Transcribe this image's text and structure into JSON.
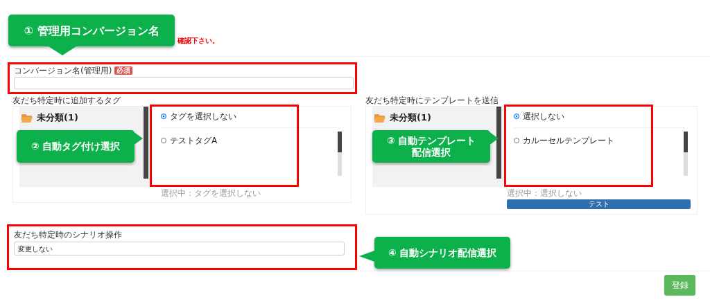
{
  "notice": "確認下さい。",
  "conversion_name": {
    "label": "コンバージョン名(管理用)",
    "badge": "必須"
  },
  "tag_section": {
    "label": "友だち特定時に追加するタグ",
    "folder": "未分類(1)",
    "options": [
      {
        "label": "タグを選択しない",
        "selected": true
      },
      {
        "label": "テストタグA",
        "selected": false
      }
    ],
    "current": "選択中：タグを選択しない"
  },
  "template_section": {
    "label": "友だち特定時にテンプレートを送信",
    "folder": "未分類(1)",
    "options": [
      {
        "label": "選択しない",
        "selected": true
      },
      {
        "label": "カルーセルテンプレート",
        "selected": false
      }
    ],
    "current": "選択中：選択しない",
    "test_button": "テスト"
  },
  "scenario": {
    "label": "友だち特定時のシナリオ操作",
    "value": "変更しない"
  },
  "submit_button": "登録",
  "annotations": [
    {
      "lines": [
        "① 管理用コンバージョン名"
      ]
    },
    {
      "lines": [
        "② 自動タグ付け選択"
      ]
    },
    {
      "lines": [
        "③ 自動テンプレート",
        "配信選択"
      ]
    },
    {
      "lines": [
        "④ 自動シナリオ配信選択"
      ]
    }
  ]
}
